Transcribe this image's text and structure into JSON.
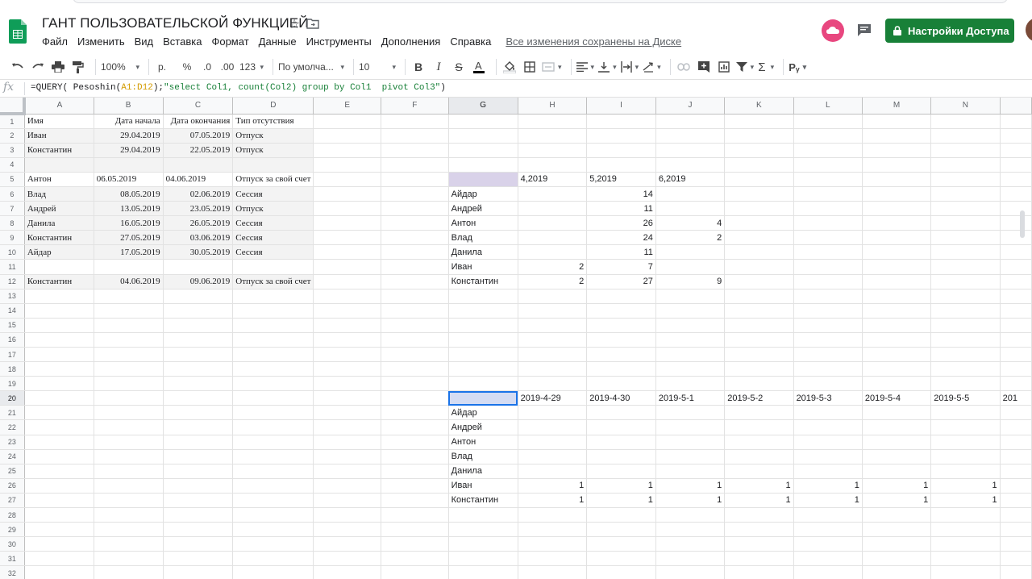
{
  "doc": {
    "title": "ГАНТ ПОЛЬЗОВАТЕЛЬСКОЙ ФУНКЦИЕЙ",
    "saved_status": "Все изменения сохранены на Диске",
    "share_label": "Настройки Доступа"
  },
  "menu": [
    "Файл",
    "Изменить",
    "Вид",
    "Вставка",
    "Формат",
    "Данные",
    "Инструменты",
    "Дополнения",
    "Справка"
  ],
  "toolbar": {
    "zoom": "100%",
    "currency": "р.",
    "percent": "%",
    "dec_less": ".0",
    "dec_more": ".00",
    "format_more": "123",
    "font": "По умолча...",
    "font_size": "10"
  },
  "formula": {
    "prefix": "=QUERY( Pesoshin(",
    "range": "A1:D12",
    "middle": ");",
    "query": "\"select Col1, count(Col2) group by Col1  pivot Col3\"",
    "suffix": ")"
  },
  "columns": [
    "A",
    "B",
    "C",
    "D",
    "E",
    "F",
    "G",
    "H",
    "I",
    "J",
    "K",
    "L",
    "M",
    "N",
    ""
  ],
  "rows": [
    "1",
    "2",
    "3",
    "4",
    "5",
    "6",
    "7",
    "8",
    "9",
    "10",
    "11",
    "12",
    "13",
    "14",
    "15",
    "16",
    "17",
    "18",
    "19",
    "20",
    "21",
    "22",
    "23",
    "24",
    "25",
    "26",
    "27",
    "28",
    "29",
    "30",
    "31",
    "32"
  ],
  "cells": {
    "A1": "Имя",
    "B1": "Дата начала",
    "C1": "Дата окончания",
    "D1": "Тип отсутствия",
    "A2": "Иван",
    "B2": "29.04.2019",
    "C2": "07.05.2019",
    "D2": "Отпуск",
    "A3": "Константин",
    "B3": "29.04.2019",
    "C3": "22.05.2019",
    "D3": "Отпуск",
    "A5": "Антон",
    "B5": "06.05.2019",
    "C5": "04.06.2019",
    "D5": "Отпуск за свой счет",
    "A6": "Влад",
    "B6": "08.05.2019",
    "C6": "02.06.2019",
    "D6": "Сессия",
    "A7": "Андрей",
    "B7": "13.05.2019",
    "C7": "23.05.2019",
    "D7": "Отпуск",
    "A8": "Данила",
    "B8": "16.05.2019",
    "C8": "26.05.2019",
    "D8": "Сессия",
    "A9": "Константин",
    "B9": "27.05.2019",
    "C9": "03.06.2019",
    "D9": "Сессия",
    "A10": "Айдар",
    "B10": "17.05.2019",
    "C10": "30.05.2019",
    "D10": "Сессия",
    "A12": "Константин",
    "B12": "04.06.2019",
    "C12": "09.06.2019",
    "D12": "Отпуск за свой счет",
    "H5": "4,2019",
    "I5": "5,2019",
    "J5": "6,2019",
    "G6": "Айдар",
    "I6": "14",
    "G7": "Андрей",
    "I7": "11",
    "G8": "Антон",
    "I8": "26",
    "J8": "4",
    "G9": "Влад",
    "I9": "24",
    "J9": "2",
    "G10": "Данила",
    "I10": "11",
    "G11": "Иван",
    "H11": "2",
    "I11": "7",
    "G12": "Константин",
    "H12": "2",
    "I12": "27",
    "J12": "9",
    "H20": "2019-4-29",
    "I20": "2019-4-30",
    "J20": "2019-5-1",
    "K20": "2019-5-2",
    "L20": "2019-5-3",
    "M20": "2019-5-4",
    "N20": "2019-5-5",
    "O20": "201",
    "G21": "Айдар",
    "G22": "Андрей",
    "G23": "Антон",
    "G24": "Влад",
    "G25": "Данила",
    "G26": "Иван",
    "H26": "1",
    "I26": "1",
    "J26": "1",
    "K26": "1",
    "L26": "1",
    "M26": "1",
    "N26": "1",
    "G27": "Константин",
    "H27": "1",
    "I27": "1",
    "J27": "1",
    "K27": "1",
    "L27": "1",
    "M27": "1",
    "N27": "1"
  }
}
